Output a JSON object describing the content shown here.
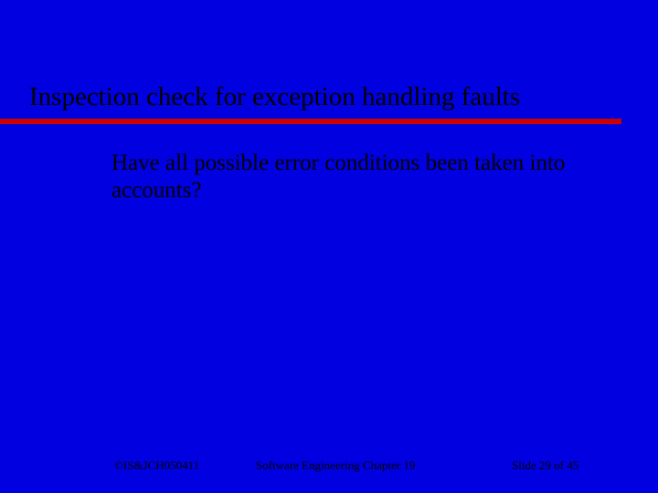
{
  "title": "Inspection check for exception handling faults",
  "body": "Have all possible error conditions been taken into accounts?",
  "footer": {
    "left": "©IS&JCH050411",
    "center": "Software Engineering  Chapter 19",
    "right": "Slide 29 of 45"
  }
}
